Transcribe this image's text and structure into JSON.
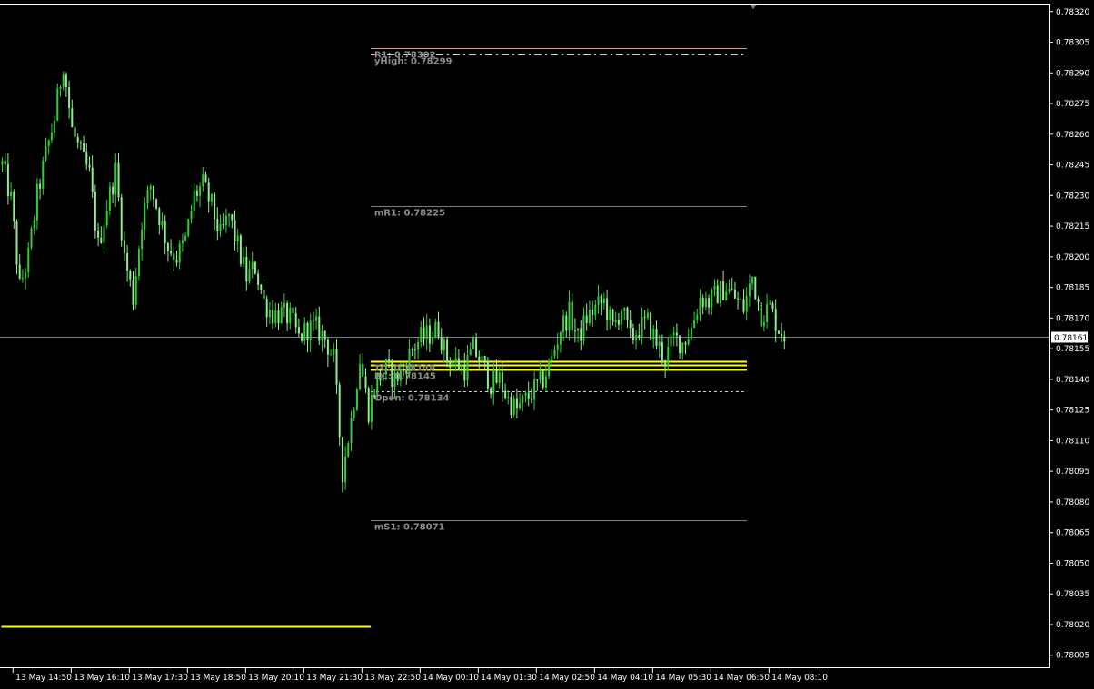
{
  "chart_data": {
    "type": "candlestick",
    "instrument_hint": "",
    "price_axis": {
      "ylim": [
        0.78,
        0.78323
      ],
      "ticks": [
        "0.78320",
        "0.78305",
        "0.78290",
        "0.78275",
        "0.78260",
        "0.78245",
        "0.78230",
        "0.78215",
        "0.78200",
        "0.78185",
        "0.78170",
        "0.78155",
        "0.78140",
        "0.78125",
        "0.78110",
        "0.78095",
        "0.78080",
        "0.78065",
        "0.78050",
        "0.78035",
        "0.78020",
        "0.78005"
      ]
    },
    "time_axis": {
      "ticks": [
        "13 May 14:50",
        "13 May 16:10",
        "13 May 17:30",
        "13 May 18:50",
        "13 May 20:10",
        "13 May 21:30",
        "13 May 22:50",
        "14 May 00:10",
        "14 May 01:30",
        "14 May 02:50",
        "14 May 04:10",
        "14 May 05:30",
        "14 May 06:50",
        "14 May 08:10"
      ]
    },
    "current_price": {
      "value": 0.78161,
      "label": "0.78161",
      "color": "#708090"
    },
    "levels": [
      {
        "name": "R1",
        "label": "R1: 0.78302",
        "value": 0.78302,
        "color": "#e9967a",
        "style": "solid",
        "start_bar": 127
      },
      {
        "name": "yHigh",
        "label": "yHigh: 0.78299",
        "value": 0.78299,
        "color": "#d3d3d3",
        "style": "dashdot",
        "start_bar": 127
      },
      {
        "name": "mR1",
        "label": "mR1: 0.78225",
        "value": 0.78225,
        "color": "#808080",
        "style": "solid",
        "start_bar": 127
      },
      {
        "name": "TC",
        "label": "TC: 0.78149",
        "value": 0.78149,
        "color": "#ffff00",
        "style": "solid",
        "start_bar": 127
      },
      {
        "name": "P",
        "label": "",
        "value": 0.78147,
        "color": "#ffff00",
        "style": "solid",
        "start_bar": 127
      },
      {
        "name": "BC",
        "label": "BC: 0.78145",
        "value": 0.78145,
        "color": "#ffff00",
        "style": "solid",
        "start_bar": 127
      },
      {
        "name": "Open",
        "label": "Open: 0.78134",
        "value": 0.78134,
        "color": "#d3d3d3",
        "style": "dashed",
        "start_bar": 127
      },
      {
        "name": "mS1",
        "label": "mS1: 0.78071",
        "value": 0.78071,
        "color": "#808080",
        "style": "solid",
        "start_bar": 127
      },
      {
        "name": "prevPivot",
        "label": "",
        "value": 0.78019,
        "color": "#ffff00",
        "style": "solid",
        "start_bar": 0,
        "end_bar": 127
      }
    ],
    "candle_colors": {
      "up": "#32cd32",
      "down": "#90ee90"
    },
    "anchors": [
      [
        0,
        0.78245
      ],
      [
        3,
        0.78228
      ],
      [
        6,
        0.78185
      ],
      [
        9,
        0.782
      ],
      [
        12,
        0.7823
      ],
      [
        15,
        0.7825
      ],
      [
        18,
        0.78268
      ],
      [
        21,
        0.78295
      ],
      [
        24,
        0.78262
      ],
      [
        27,
        0.7825
      ],
      [
        30,
        0.7824
      ],
      [
        33,
        0.78205
      ],
      [
        36,
        0.78225
      ],
      [
        39,
        0.78242
      ],
      [
        42,
        0.782
      ],
      [
        45,
        0.7818
      ],
      [
        48,
        0.78218
      ],
      [
        51,
        0.78235
      ],
      [
        54,
        0.7822
      ],
      [
        57,
        0.78205
      ],
      [
        60,
        0.782
      ],
      [
        63,
        0.78208
      ],
      [
        66,
        0.7823
      ],
      [
        69,
        0.78235
      ],
      [
        72,
        0.78225
      ],
      [
        75,
        0.7821
      ],
      [
        78,
        0.7822
      ],
      [
        81,
        0.78205
      ],
      [
        84,
        0.7819
      ],
      [
        87,
        0.78195
      ],
      [
        90,
        0.78178
      ],
      [
        93,
        0.78172
      ],
      [
        96,
        0.78172
      ],
      [
        99,
        0.7817
      ],
      [
        102,
        0.7816
      ],
      [
        105,
        0.78165
      ],
      [
        108,
        0.78165
      ],
      [
        111,
        0.7816
      ],
      [
        114,
        0.7815
      ],
      [
        117,
        0.78095
      ],
      [
        120,
        0.7812
      ],
      [
        123,
        0.7815
      ],
      [
        126,
        0.78125
      ],
      [
        129,
        0.7814
      ],
      [
        132,
        0.78145
      ],
      [
        135,
        0.7814
      ],
      [
        138,
        0.78145
      ],
      [
        141,
        0.78155
      ],
      [
        144,
        0.7816
      ],
      [
        147,
        0.78162
      ],
      [
        150,
        0.78165
      ],
      [
        153,
        0.7815
      ],
      [
        156,
        0.78148
      ],
      [
        159,
        0.78145
      ],
      [
        162,
        0.78155
      ],
      [
        165,
        0.78148
      ],
      [
        168,
        0.78138
      ],
      [
        171,
        0.7814
      ],
      [
        174,
        0.7813
      ],
      [
        177,
        0.78125
      ],
      [
        180,
        0.7813
      ],
      [
        183,
        0.78135
      ],
      [
        186,
        0.7814
      ],
      [
        189,
        0.7815
      ],
      [
        192,
        0.78165
      ],
      [
        195,
        0.78172
      ],
      [
        198,
        0.7816
      ],
      [
        201,
        0.7817
      ],
      [
        204,
        0.78175
      ],
      [
        207,
        0.78178
      ],
      [
        210,
        0.78165
      ],
      [
        213,
        0.78175
      ],
      [
        216,
        0.7816
      ],
      [
        219,
        0.78165
      ],
      [
        222,
        0.78168
      ],
      [
        225,
        0.78158
      ],
      [
        228,
        0.7815
      ],
      [
        231,
        0.7816
      ],
      [
        234,
        0.78158
      ],
      [
        237,
        0.78165
      ],
      [
        240,
        0.7818
      ],
      [
        243,
        0.78178
      ],
      [
        246,
        0.78182
      ],
      [
        249,
        0.78185
      ],
      [
        252,
        0.7818
      ],
      [
        255,
        0.78175
      ],
      [
        258,
        0.7819
      ],
      [
        261,
        0.78172
      ],
      [
        264,
        0.78175
      ],
      [
        267,
        0.78165
      ],
      [
        269,
        0.78162
      ]
    ],
    "bar_count": 270
  }
}
